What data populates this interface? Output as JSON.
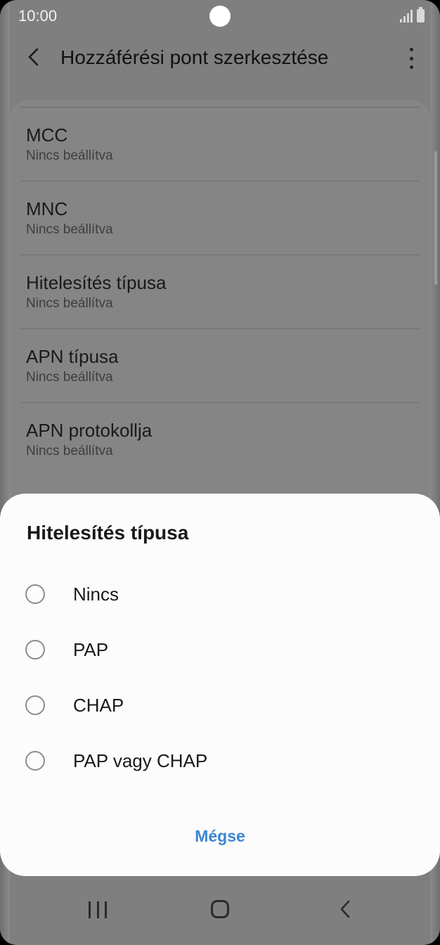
{
  "status_bar": {
    "time": "10:00",
    "icons": [
      "signal-icon",
      "battery-icon"
    ]
  },
  "app_bar": {
    "title": "Hozzáférési pont szerkesztése",
    "back_icon": "chevron-left-icon",
    "more_icon": "more-vertical-icon"
  },
  "settings": {
    "items": [
      {
        "title": "MCC",
        "value": "Nincs beállítva"
      },
      {
        "title": "MNC",
        "value": "Nincs beállítva"
      },
      {
        "title": "Hitelesítés típusa",
        "value": "Nincs beállítva"
      },
      {
        "title": "APN típusa",
        "value": "Nincs beállítva"
      },
      {
        "title": "APN protokollja",
        "value": "Nincs beállítva"
      }
    ]
  },
  "dialog": {
    "title": "Hitelesítés típusa",
    "options": [
      {
        "label": "Nincs",
        "selected": false
      },
      {
        "label": "PAP",
        "selected": false
      },
      {
        "label": "CHAP",
        "selected": false
      },
      {
        "label": "PAP vagy CHAP",
        "selected": false
      }
    ],
    "cancel_label": "Mégse",
    "accent_color": "#3d86d1"
  },
  "nav_bar": {
    "icons": [
      "recents-icon",
      "home-icon",
      "back-icon"
    ]
  }
}
